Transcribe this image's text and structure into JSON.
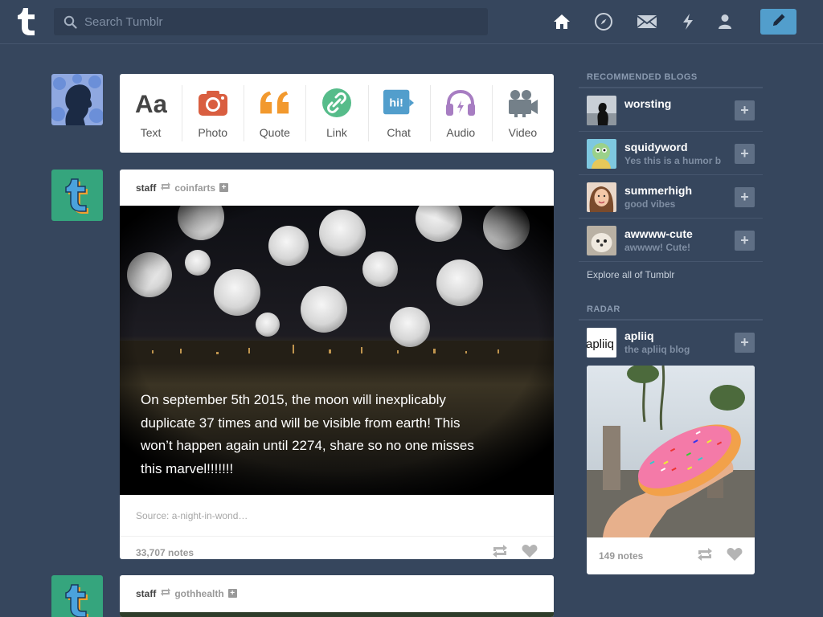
{
  "header": {
    "search_placeholder": "Search Tumblr",
    "nav_icons": [
      "home-icon",
      "explore-icon",
      "inbox-icon",
      "activity-icon",
      "account-icon"
    ],
    "compose_icon": "pencil-icon",
    "colors": {
      "background": "#36465d",
      "accent": "#529ecc"
    }
  },
  "post_types": [
    {
      "label": "Text",
      "icon": "text-icon",
      "color": "#444444"
    },
    {
      "label": "Photo",
      "icon": "camera-icon",
      "color": "#d95e40"
    },
    {
      "label": "Quote",
      "icon": "quote-icon",
      "color": "#f2992e"
    },
    {
      "label": "Link",
      "icon": "link-icon",
      "color": "#56bc8a"
    },
    {
      "label": "Chat",
      "icon": "chat-icon",
      "color": "#529ecc"
    },
    {
      "label": "Audio",
      "icon": "headphones-icon",
      "color": "#a77dc2"
    },
    {
      "label": "Video",
      "icon": "video-camera-icon",
      "color": "#748089"
    }
  ],
  "posts": [
    {
      "blog": "staff",
      "reblogged_from": "coinfarts",
      "caption": "On september 5th 2015, the moon will inexplicably duplicate 37 times and will be visible from earth! This won’t happen again until 2274, share so no one misses this marvel!!!!!!!",
      "source": "Source: a-night-in-wond…",
      "notes": "33,707 notes"
    },
    {
      "blog": "staff",
      "reblogged_from": "gothhealth"
    }
  ],
  "sidebar": {
    "recommended_title": "RECOMMENDED BLOGS",
    "recommended": [
      {
        "name": "worsting",
        "desc": ""
      },
      {
        "name": "squidyword",
        "desc": "Yes this is a humor b"
      },
      {
        "name": "summerhigh",
        "desc": "good vibes"
      },
      {
        "name": "awwww-cute",
        "desc": "awwww! Cute!"
      }
    ],
    "follow_label": "+",
    "explore_label": "Explore all of Tumblr",
    "radar_title": "RADAR",
    "radar": {
      "name": "apliiq",
      "desc": "the apliiq blog",
      "avatar_text": "apliiq",
      "notes": "149 notes"
    }
  }
}
